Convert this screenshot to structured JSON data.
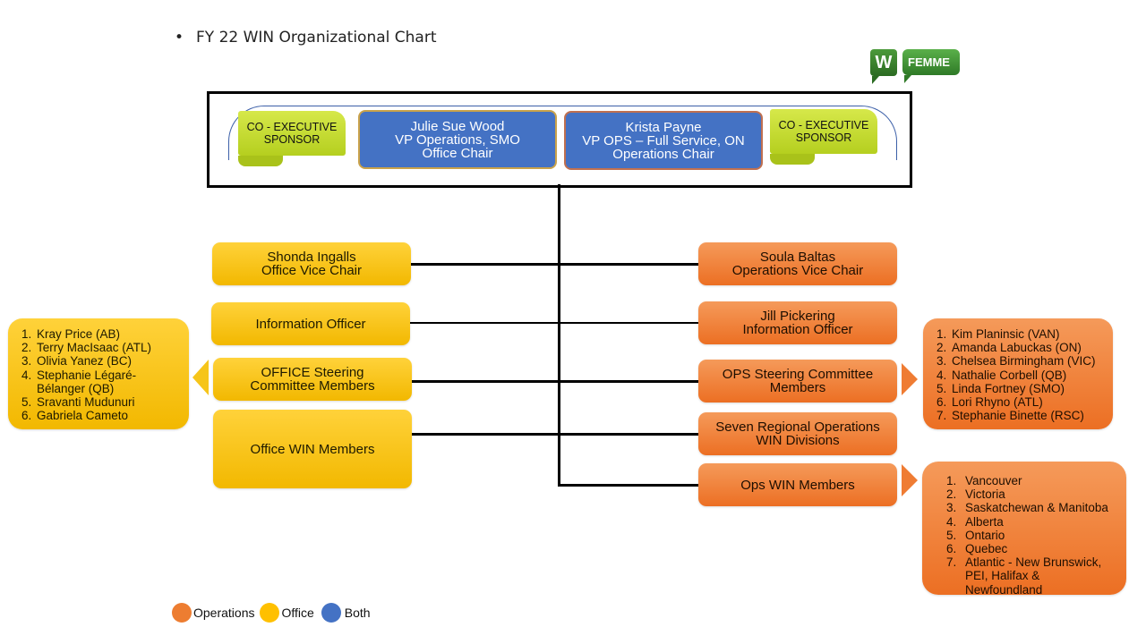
{
  "slide": {
    "title": "FY 22 WIN Organizational Chart",
    "bullet": "•"
  },
  "logo": {
    "icon_letter": "W",
    "brand": "FEMME",
    "color": "#3a8a2e"
  },
  "colors": {
    "operations": "#ed7d31",
    "office": "#ffc000",
    "both": "#4472c4",
    "sponsor": "#c4d92c"
  },
  "top": {
    "sponsor_left": "CO - EXECUTIVE SPONSOR",
    "sponsor_right": "CO - EXECUTIVE SPONSOR",
    "chair_left": {
      "name": "Julie Sue Wood",
      "title": "VP Operations, SMO",
      "role": "Office Chair"
    },
    "chair_right": {
      "name": "Krista Payne",
      "title": "VP OPS – Full Service, ON",
      "role": "Operations Chair"
    }
  },
  "office": {
    "vice_chair": {
      "name": "Shonda Ingalls",
      "role": "Office Vice Chair"
    },
    "info_officer": "Information  Officer",
    "steering": [
      "OFFICE Steering",
      "Committee Members"
    ],
    "win_members": "Office WIN  Members",
    "steering_members": [
      "Kray Price (AB)",
      "Terry MacIsaac (ATL)",
      "Olivia Yanez (BC)",
      "Stephanie Légaré-Bélanger (QB)",
      "Sravanti Mudunuri",
      "Gabriela Cameto"
    ]
  },
  "operations": {
    "vice_chair": {
      "name": "Soula Baltas",
      "role": "Operations Vice Chair"
    },
    "info_officer": {
      "name": "Jill Pickering",
      "role": "Information  Officer"
    },
    "steering": [
      "OPS Steering Committee",
      "Members"
    ],
    "divisions": [
      "Seven Regional Operations",
      "WIN  Divisions"
    ],
    "win_members": "Ops WIN Members",
    "steering_members": [
      "Kim Planinsic (VAN)",
      "Amanda Labuckas (ON)",
      "Chelsea Birmingham  (VIC)",
      "Nathalie Corbell (QB)",
      "Linda Fortney (SMO)",
      "Lori Rhyno (ATL)",
      "Stephanie Binette (RSC)"
    ],
    "regions": [
      "Vancouver",
      "Victoria",
      "Saskatchewan & Manitoba",
      "Alberta",
      "Ontario",
      "Quebec",
      "Atlantic - New  Brunswick, PEI,  Halifax  & Newfoundland"
    ]
  },
  "legend": [
    {
      "label": "Operations",
      "color": "#ed7d31"
    },
    {
      "label": "Office",
      "color": "#ffc000"
    },
    {
      "label": "Both",
      "color": "#4472c4"
    }
  ]
}
